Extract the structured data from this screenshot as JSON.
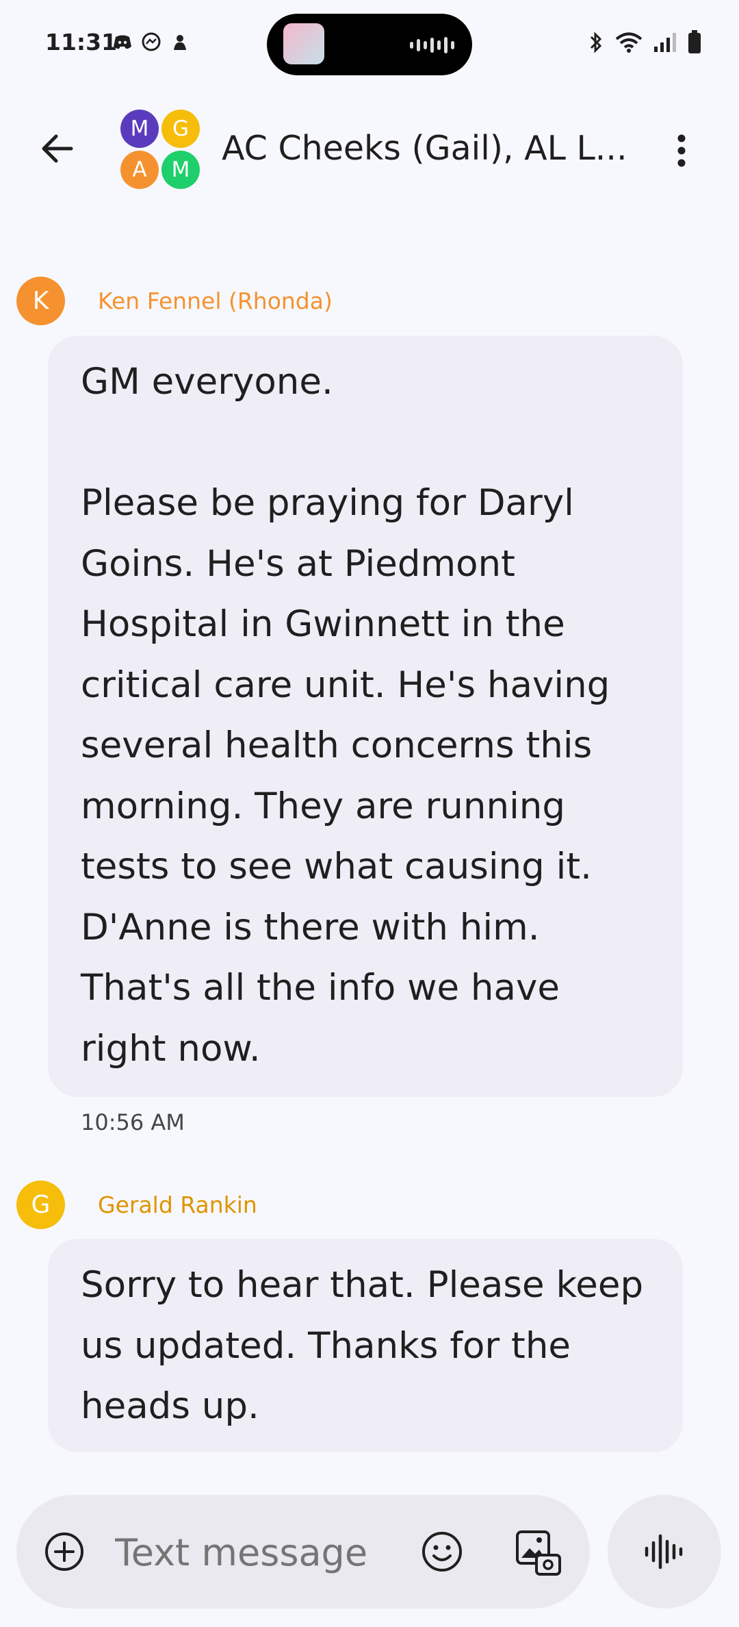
{
  "status_bar": {
    "time": "11:31",
    "icons": [
      "discord-icon",
      "messenger-icon",
      "notification-icon",
      "bluetooth-icon",
      "wifi-icon",
      "signal-icon",
      "battery-icon"
    ]
  },
  "header": {
    "back_icon": "arrow-back-icon",
    "group_avatars": [
      {
        "initial": "M",
        "color": "#5b3bbd"
      },
      {
        "initial": "G",
        "color": "#f6bd0a"
      },
      {
        "initial": "A",
        "color": "#f5922f"
      },
      {
        "initial": "M",
        "color": "#1ecf6b"
      }
    ],
    "title": "AC Cheeks (Gail), AL L...",
    "more_icon": "more-vert-icon"
  },
  "messages": [
    {
      "sender_initial": "K",
      "sender_name": "Ken Fennel (Rhonda)",
      "avatar_color": "#f5922f",
      "name_color": "#f5922f",
      "text": "GM everyone.\n\nPlease be praying for Daryl Goins. He's at Piedmont Hospital in Gwinnett in the critical care unit. He's having several health concerns this morning. They are running tests to see what causing it. D'Anne is there with him. That's all the info we have right now.",
      "timestamp": "10:56 AM"
    },
    {
      "sender_initial": "G",
      "sender_name": "Gerald Rankin",
      "avatar_color": "#f6bd0a",
      "name_color": "#e09300",
      "text": "Sorry to hear that. Please keep us updated. Thanks for the heads up."
    }
  ],
  "compose": {
    "placeholder": "Text message",
    "add_icon": "add-circle-icon",
    "emoji_icon": "emoji-icon",
    "media_icon": "gallery-icon",
    "voice_icon": "voice-waveform-icon"
  }
}
